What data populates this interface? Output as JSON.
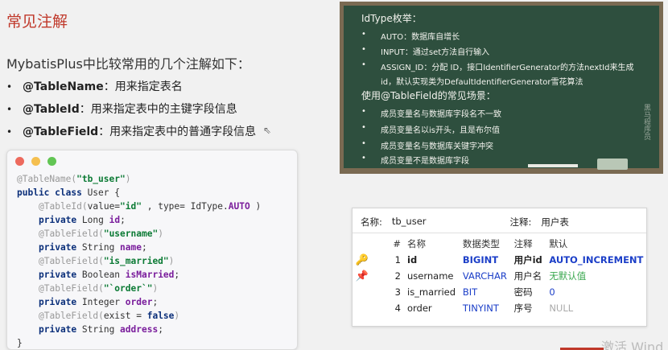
{
  "title": "常见注解",
  "intro": "MybatisPlus中比较常用的几个注解如下：",
  "annotations": [
    {
      "name": "@TableName",
      "desc": "：用来指定表名"
    },
    {
      "name": "@TableId",
      "desc": "：用来指定表中的主键字段信息"
    },
    {
      "name": "@TableField",
      "desc": "：用来指定表中的普通字段信息"
    }
  ],
  "code": {
    "l1_ann": "@TableName(",
    "l1_str": "\"tb_user\"",
    "l1_end": ")",
    "l2": "public class",
    "l2_rest": " User {",
    "l3_ann": "@TableId(",
    "l3_a": "value=",
    "l3_str": "\"id\"",
    "l3_b": " , type= IdType.",
    "l3_enum": "AUTO",
    "l3_end": " )",
    "l4_kw": "private",
    "l4_type": " Long ",
    "l4_fld": "id",
    "l5_ann": "@TableField(",
    "l5_str": "\"username\"",
    "l5_end": ")",
    "l6_kw": "private",
    "l6_type": " String ",
    "l6_fld": "name",
    "l7_ann": "@TableField(",
    "l7_str": "\"is_married\"",
    "l7_end": ")",
    "l8_kw": "private",
    "l8_type": " Boolean ",
    "l8_fld": "isMarried",
    "l9_ann": "@TableField(",
    "l9_str": "\"`order`\"",
    "l9_end": ")",
    "l10_kw": "private",
    "l10_type": " Integer ",
    "l10_fld": "order",
    "l11_ann": "@TableField(",
    "l11_a": "exist = ",
    "l11_kw": "false",
    "l11_end": ")",
    "l12_kw": "private",
    "l12_type": " String ",
    "l12_fld": "address",
    "l13": "}"
  },
  "board": {
    "h1": "IdType枚举：",
    "items1": [
      "AUTO：数据库自增长",
      "INPUT：通过set方法自行输入",
      "ASSIGN_ID：分配 ID，接口IdentifierGenerator的方法nextId来生成",
      "id，默认实现类为DefaultIdentifierGenerator雪花算法"
    ],
    "h2": "使用@TableField的常见场景：",
    "items2": [
      "成员变量名与数据库字段名不一致",
      "成员变量名以is开头，且是布尔值",
      "成员变量名与数据库关键字冲突",
      "成员变量不是数据库字段"
    ],
    "signature": "黑马程序员"
  },
  "table_panel": {
    "name_label": "名称:",
    "name_value": "tb_user",
    "comment_label": "注释:",
    "comment_value": "用户表",
    "headers": [
      "#",
      "名称",
      "数据类型",
      "注释",
      "默认"
    ],
    "rows": [
      {
        "key": "pk",
        "num": "1",
        "name": "id",
        "type": "BIGINT",
        "comment": "用户id",
        "default": "AUTO_INCREMENT"
      },
      {
        "key": "uk",
        "num": "2",
        "name": "username",
        "type": "VARCHAR",
        "comment": "用户名",
        "default": "无默认值"
      },
      {
        "key": "",
        "num": "3",
        "name": "is_married",
        "type": "BIT",
        "comment": "密码",
        "default": "0"
      },
      {
        "key": "",
        "num": "4",
        "name": "order",
        "type": "TINYINT",
        "comment": "序号",
        "default": "NULL"
      }
    ]
  },
  "watermark": "激活 Wind",
  "colors": {
    "title": "#c0392b",
    "board": "#2e4f3e",
    "selection": "#cfe3fb"
  }
}
